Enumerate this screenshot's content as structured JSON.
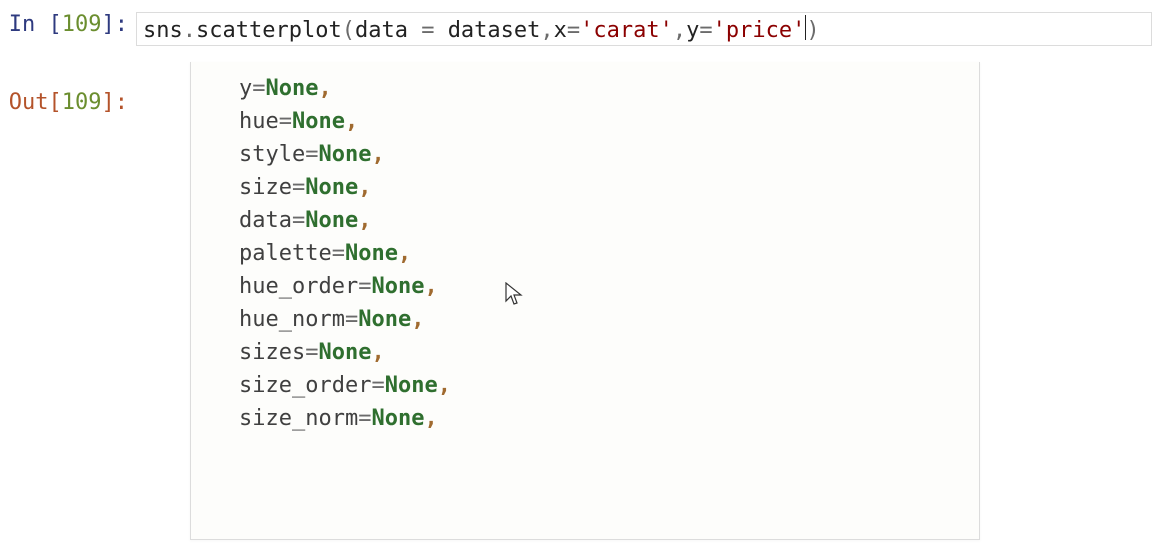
{
  "cell": {
    "in_label_prefix": "In ",
    "out_label_prefix": "Out",
    "exec_count": "109",
    "code": {
      "obj": "sns",
      "dot": ".",
      "func": "scatterplot",
      "open": "(",
      "kw1": "data",
      "eq": "=",
      "sp": " ",
      "val1": "dataset",
      "comma": ",",
      "kw2": "x",
      "str1": "'carat'",
      "kw3": "y",
      "str2": "'price'",
      "close": ")"
    }
  },
  "tooltip": {
    "params": [
      {
        "name": "y",
        "value": "None"
      },
      {
        "name": "hue",
        "value": "None"
      },
      {
        "name": "style",
        "value": "None"
      },
      {
        "name": "size",
        "value": "None"
      },
      {
        "name": "data",
        "value": "None"
      },
      {
        "name": "palette",
        "value": "None"
      },
      {
        "name": "hue_order",
        "value": "None"
      },
      {
        "name": "hue_norm",
        "value": "None"
      },
      {
        "name": "sizes",
        "value": "None"
      },
      {
        "name": "size_order",
        "value": "None"
      },
      {
        "name": "size_norm",
        "value": "None"
      }
    ]
  }
}
